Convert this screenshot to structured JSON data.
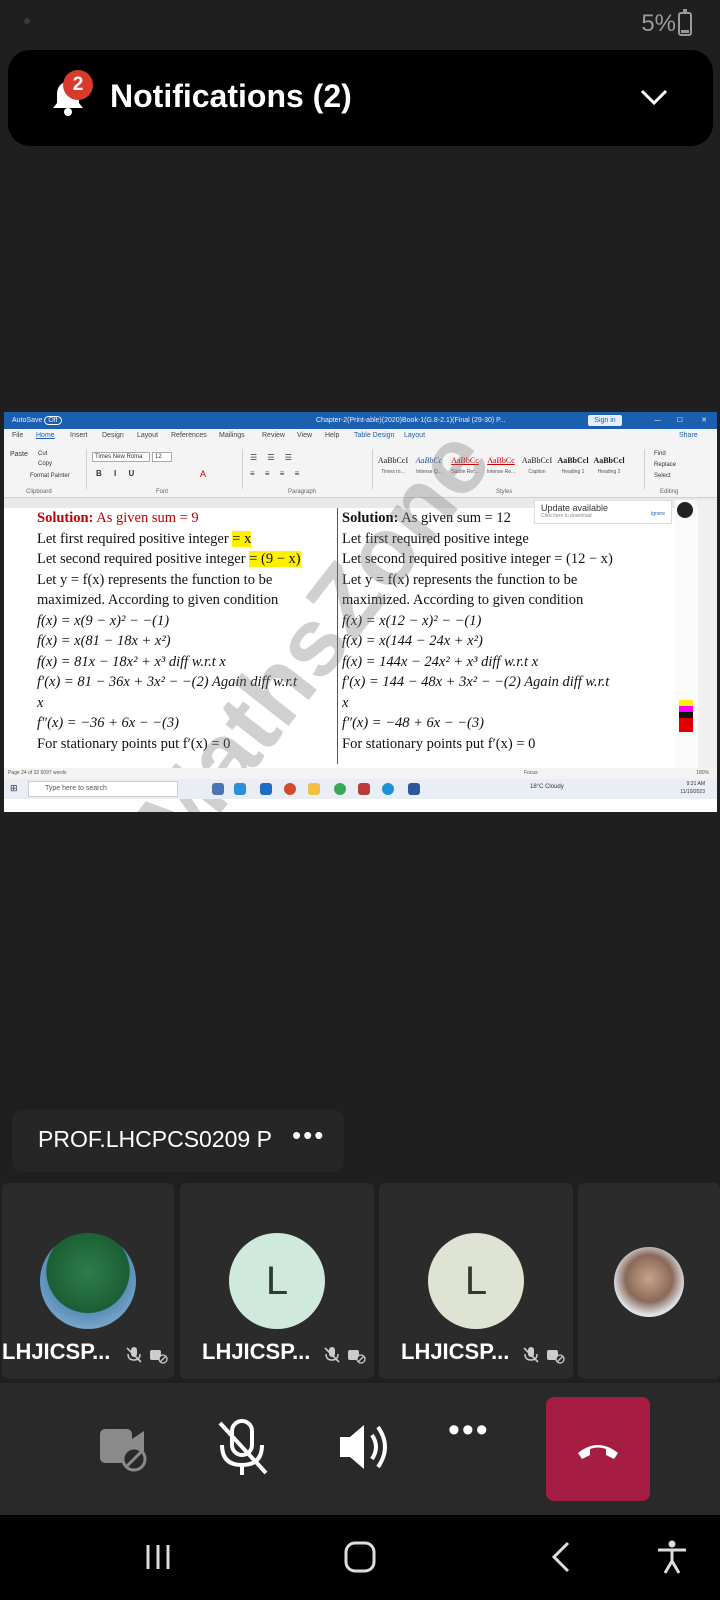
{
  "status_bar": {
    "battery": "5%"
  },
  "notification": {
    "badge_count": "2",
    "title": "Notifications (2)"
  },
  "word": {
    "autosave": "AutoSave",
    "autosave_state": "Off",
    "doc_title": "Chapter-2(Print-able)(2020)Book-1(G.8-2.1)(Final (29-30) P...",
    "signin": "Sign in",
    "menus": [
      "File",
      "Home",
      "Insert",
      "Design",
      "Layout",
      "References",
      "Mailings",
      "Review",
      "View",
      "Help",
      "Table Design",
      "Layout"
    ],
    "share": "Share",
    "font_name": "Times New Roma",
    "font_size": "12",
    "groups": [
      "Clipboard",
      "Font",
      "Paragraph",
      "Styles",
      "Editing"
    ],
    "clipboard_items": [
      "Paste",
      "Cut",
      "Copy",
      "Format Painter"
    ],
    "styles": [
      {
        "sample": "AaBbCcI",
        "label": "Times ro..."
      },
      {
        "sample": "AaBbCc",
        "label": "Intense Q..."
      },
      {
        "sample": "AaBbCc",
        "label": "Subtle Ref..."
      },
      {
        "sample": "AaBbCc",
        "label": "Intense Re..."
      },
      {
        "sample": "AaBbCcI",
        "label": "Caption"
      },
      {
        "sample": "AaBbCcl",
        "label": "Heading 1"
      },
      {
        "sample": "AaBbCcl",
        "label": "Heading 2"
      }
    ],
    "editing_items": [
      "Find",
      "Replace",
      "Select"
    ],
    "update_popup": {
      "title": "Update available",
      "sub": "Click here to download",
      "ignore": "Ignore"
    },
    "watermark": "MathsZone",
    "left_col": [
      {
        "pre": "Solution:",
        "post": " As given sum = 9"
      },
      {
        "text": "Let first required positive integer ",
        "hl": "= x"
      },
      {
        "text": "Let second required positive integer ",
        "hl": "= (9 − x)"
      },
      {
        "text": "Let  y = f(x)  represents the function to be"
      },
      {
        "text": "maximized. According to given condition"
      },
      {
        "text": " f(x) = x(9 − x)²  − −(1)"
      },
      {
        "text": " f(x) = x(81 − 18x + x²)"
      },
      {
        "text": " f(x) = 81x − 18x² + x³  diff w.r.t  x"
      },
      {
        "text": " f′(x) = 81 − 36x + 3x² − −(2)   Again diff w.r.t"
      },
      {
        "text": " x"
      },
      {
        "text": " f″(x) = −36 + 6x − −(3)"
      },
      {
        "text": "For stationary  points put  f′(x) = 0"
      }
    ],
    "right_col": [
      {
        "pre": "Solution:",
        "post": " As given sum = 12"
      },
      {
        "text": "Let first required positive intege"
      },
      {
        "text": "Let second required positive integer  = (12 − x)"
      },
      {
        "text": "Let  y = f(x)  represents the function to be"
      },
      {
        "text": "maximized. According to given condition"
      },
      {
        "text": " f(x) = x(12 − x)²  − −(1)"
      },
      {
        "text": " f(x) = x(144 − 24x + x²)"
      },
      {
        "text": " f(x) = 144x − 24x² + x³  diff w.r.t  x"
      },
      {
        "text": " f′(x) = 144 − 48x + 3x² − −(2)  Again diff w.r.t"
      },
      {
        "text": " x"
      },
      {
        "text": " f″(x) = −48 + 6x − −(3)"
      },
      {
        "text": "For stationary  points put  f′(x) = 0"
      }
    ],
    "status_left": "Page 24 of 32    5097 words",
    "focus": "Focus",
    "zoom": "180%"
  },
  "taskbar": {
    "search_placeholder": "Type here to search",
    "weather": "18°C  Cloudy",
    "time": "9:31 AM",
    "date": "11/10/2023"
  },
  "presenter": {
    "name": "PROF.LHCPCS0209 P",
    "more": "•••"
  },
  "participants": [
    {
      "name": "LHJICSP...",
      "initial": ""
    },
    {
      "name": "LHJICSP...",
      "initial": "L"
    },
    {
      "name": "LHJICSP...",
      "initial": "L"
    },
    {
      "name": "",
      "initial": ""
    }
  ],
  "controls": {
    "more": "•••"
  },
  "colors": {
    "background": "#1f1f1f",
    "hangup": "#a51d43",
    "badge": "#d83b2b",
    "word_blue": "#1b5fb0",
    "solution_red": "#c00000",
    "highlight": "#ffef00",
    "avatar_l1": "#cfe9dc",
    "avatar_l2": "#dfe3d4"
  },
  "icons": [
    "bell-icon",
    "chevron-down-icon",
    "camera-off-icon",
    "mic-off-icon",
    "speaker-icon",
    "more-icon",
    "hang-up-icon",
    "recents-icon",
    "home-icon",
    "back-icon",
    "accessibility-icon"
  ]
}
